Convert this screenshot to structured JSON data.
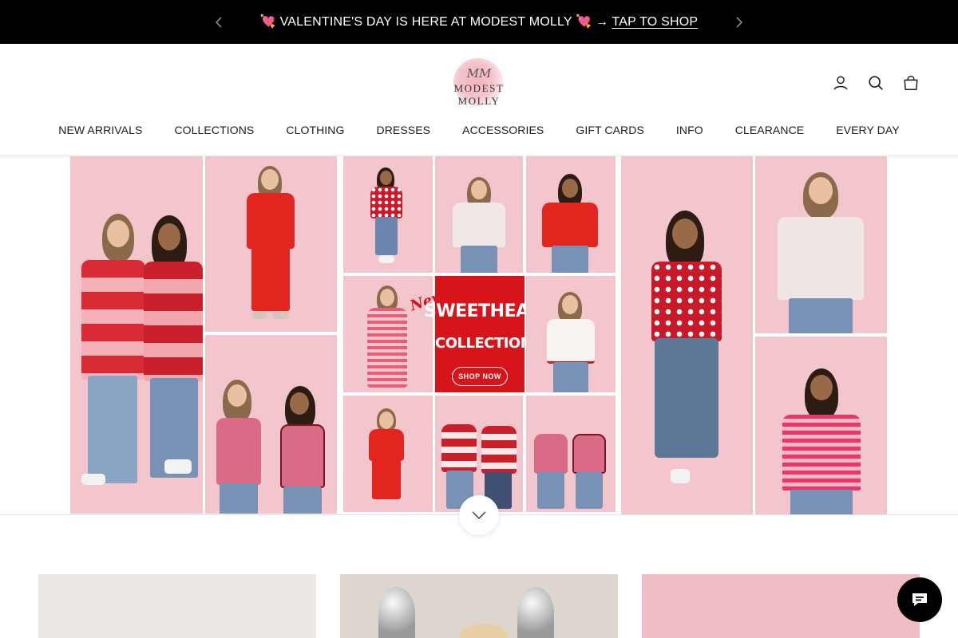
{
  "announcement": {
    "heart": "💘",
    "message": "VALENTINE'S DAY IS HERE AT MODEST MOLLY",
    "arrow": "→",
    "link_label": "TAP TO SHOP",
    "prev_icon": "chevron-left-icon",
    "next_icon": "chevron-right-icon"
  },
  "logo": {
    "monogram": "MM",
    "wordmark": "MODEST MOLLY"
  },
  "header_icons": [
    "account-icon",
    "search-icon",
    "cart-icon"
  ],
  "nav": {
    "items": [
      {
        "label": "NEW ARRIVALS"
      },
      {
        "label": "COLLECTIONS"
      },
      {
        "label": "CLOTHING"
      },
      {
        "label": "DRESSES"
      },
      {
        "label": "ACCESSORIES"
      },
      {
        "label": "GIFT CARDS"
      },
      {
        "label": "INFO"
      },
      {
        "label": "CLEARANCE"
      },
      {
        "label": "EVERY DAY"
      }
    ]
  },
  "hero": {
    "badge": "New!",
    "title_line1": "SWEETHEART'S",
    "title_line2": "COLLECTION",
    "cta_label": "SHOP NOW",
    "scroll_icon": "chevron-down-icon"
  },
  "chat": {
    "icon": "chat-icon"
  },
  "colors": {
    "announcement_bg": "#000000",
    "brand_pink": "#f3c4cb",
    "promo_red": "#d7141a"
  }
}
